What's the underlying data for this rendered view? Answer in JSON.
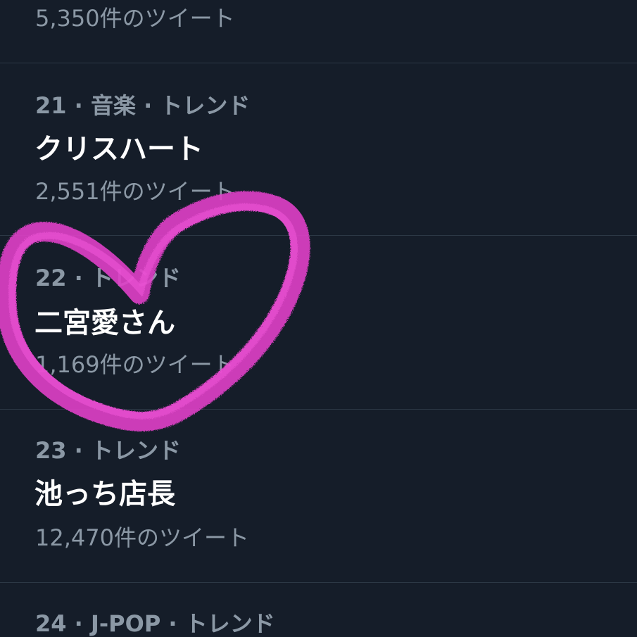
{
  "trends": [
    {
      "meta": "",
      "title": "",
      "count": "5,350件のツイート"
    },
    {
      "meta": "21 · 音楽 · トレンド",
      "title": "クリスハート",
      "count": "2,551件のツイート"
    },
    {
      "meta": "22 · トレンド",
      "title": "二宮愛さん",
      "count": "1,169件のツイート"
    },
    {
      "meta": "23 · トレンド",
      "title": "池っち店長",
      "count": "12,470件のツイート"
    },
    {
      "meta": "24 · J-POP · トレンド",
      "title": "",
      "count": ""
    }
  ],
  "annotation": {
    "shape": "heart-doodle",
    "color": "#e03fc8"
  },
  "colors": {
    "background": "#151d29",
    "divider": "#2c3845",
    "secondary_text": "#8b98a5",
    "primary_text": "#ffffff"
  }
}
